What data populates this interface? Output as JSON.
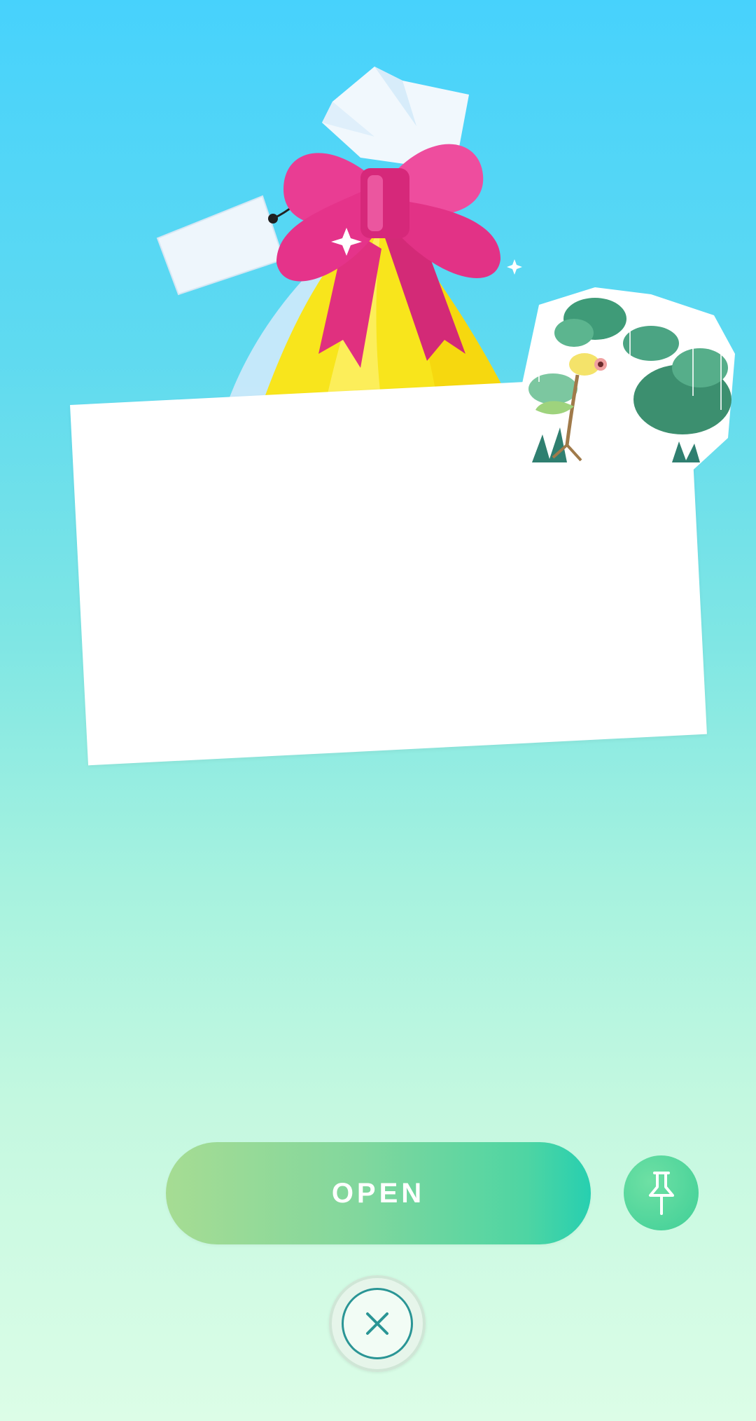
{
  "gift": {
    "icon": "gift-icon"
  },
  "sticker": {
    "icon": "sticker-bellsprout-rain-icon"
  },
  "card": {
    "text": ""
  },
  "actions": {
    "open_label": "OPEN",
    "pin_icon": "pin-icon",
    "close_icon": "close-icon"
  },
  "colors": {
    "background_top": "#47d2fc",
    "background_bottom": "#dcfde7",
    "ribbon": "#e5338a",
    "gift_wrap": "#f7e51f",
    "open_button_start": "#a6dc93",
    "open_button_end": "#27cfb0",
    "close_ring": "#2a9595"
  }
}
